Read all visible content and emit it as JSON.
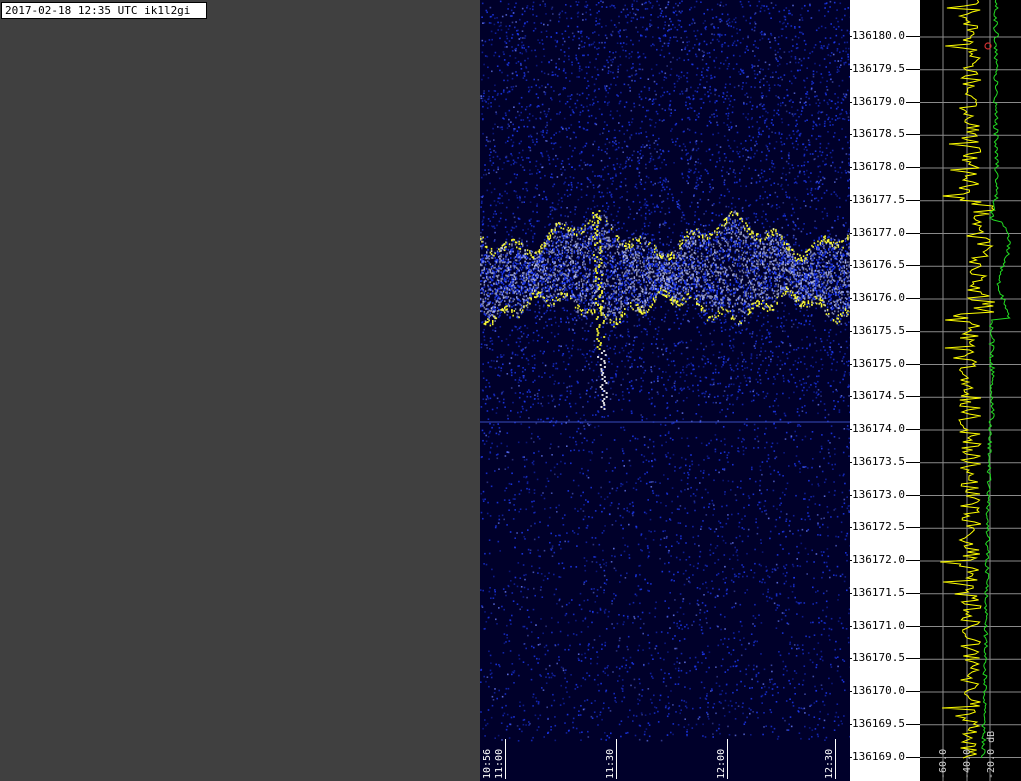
{
  "header": {
    "title": "2017-02-18 12:35 UTC ik1l2gi"
  },
  "frequency_axis": {
    "ticks": [
      "136180.0",
      "136179.5",
      "136179.0",
      "136178.5",
      "136178.0",
      "136177.5",
      "136177.0",
      "136176.5",
      "136176.0",
      "136175.5",
      "136175.0",
      "136174.5",
      "136174.0",
      "136173.5",
      "136173.0",
      "136172.5",
      "136172.0",
      "136171.5",
      "136171.0",
      "136170.5",
      "136170.0",
      "136169.5",
      "136169.0"
    ]
  },
  "time_axis": {
    "labels": [
      "10:56",
      "11:00",
      "11:30",
      "12:00",
      "12:30"
    ]
  },
  "level_axis": {
    "labels": [
      "-60.0",
      "-40.0",
      "-20.0 dB"
    ]
  },
  "colors": {
    "background": "#404040",
    "spectrogram_bg": "#00002a",
    "noise": "#1e3cff",
    "signal_strong": "#ffff30",
    "signal_mid": "#c8d0ff",
    "trace_peak": "#ffff00",
    "trace_avg": "#22dd22"
  }
}
